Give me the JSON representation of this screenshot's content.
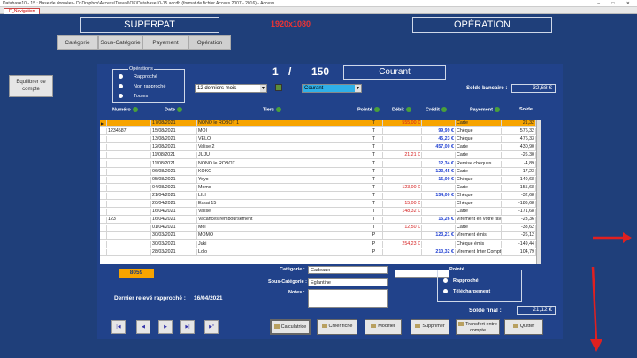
{
  "window": {
    "title": "Database10 - 15 : Base de données- D:\\Dropbox\\Access\\Travail\\OK\\Database10-15.accdb (format de fichier Access 2007 - 2016) - Access",
    "nav_tab": "F_Navigation",
    "controls": [
      "–",
      "□",
      "✕"
    ]
  },
  "header": {
    "left_title": "SUPERPAT",
    "resolution": "1920x1080",
    "right_title": "OPÉRATION"
  },
  "tabs": [
    "Catégorie",
    "Sous-Catégorie",
    "Payement",
    "Opération"
  ],
  "left_button": "Equilibrer ce compte",
  "operations_filter": {
    "legend": "Opérations",
    "options": [
      "Rapproché",
      "Non rapproché",
      "Toutes"
    ]
  },
  "pager": {
    "current": "1",
    "separator": "/",
    "total": "150"
  },
  "account_name": "Courant",
  "period_select": "12 derniers mois",
  "account_select": "Courant",
  "bank_balance": {
    "label": "Solde bancaire :",
    "value": "-32,68 €"
  },
  "columns": [
    "Numéro",
    "Date",
    "Tiers",
    "Pointé",
    "Débit",
    "Crédit",
    "Payement",
    "Solde"
  ],
  "rows": [
    {
      "num": "",
      "date": "17/08/2021",
      "tiers": "NONO le ROBOT 1",
      "pointe": "T",
      "debit": "555,00 €",
      "credit": "",
      "payement": "Carte",
      "solde": "21,32"
    },
    {
      "num": "1234587",
      "date": "15/08/2021",
      "tiers": "MOI",
      "pointe": "T",
      "debit": "",
      "credit": "99,99 €",
      "payement": "Chèque",
      "solde": "576,32"
    },
    {
      "num": "",
      "date": "13/08/2021",
      "tiers": "VELO",
      "pointe": "T",
      "debit": "",
      "credit": "45,23 €",
      "payement": "Chèque",
      "solde": "476,33"
    },
    {
      "num": "",
      "date": "12/08/2021",
      "tiers": "Valise 2",
      "pointe": "T",
      "debit": "",
      "credit": "457,00 €",
      "payement": "Carte",
      "solde": "430,90"
    },
    {
      "num": "",
      "date": "11/08/2021",
      "tiers": "JUJU",
      "pointe": "T",
      "debit": "21,21 €",
      "credit": "",
      "payement": "Carte",
      "solde": "-26,30"
    },
    {
      "num": "",
      "date": "11/08/2021",
      "tiers": "NONO le ROBOT",
      "pointe": "T",
      "debit": "",
      "credit": "12,34 €",
      "payement": "Remise chèques",
      "solde": "-4,89"
    },
    {
      "num": "",
      "date": "06/08/2021",
      "tiers": "KOKO",
      "pointe": "T",
      "debit": "",
      "credit": "123,45 €",
      "payement": "Carte",
      "solde": "-17,23"
    },
    {
      "num": "",
      "date": "05/08/2021",
      "tiers": "Yoyo",
      "pointe": "T",
      "debit": "",
      "credit": "15,00 €",
      "payement": "Chèque",
      "solde": "-140,68"
    },
    {
      "num": "",
      "date": "04/08/2021",
      "tiers": "Momo",
      "pointe": "T",
      "debit": "123,00 €",
      "credit": "",
      "payement": "Carte",
      "solde": "-155,68"
    },
    {
      "num": "",
      "date": "21/04/2021",
      "tiers": "LILI",
      "pointe": "T",
      "debit": "",
      "credit": "154,00 €",
      "payement": "Chèque",
      "solde": "-32,68"
    },
    {
      "num": "",
      "date": "20/04/2021",
      "tiers": "Essai 15",
      "pointe": "T",
      "debit": "15,00 €",
      "credit": "",
      "payement": "Chèque",
      "solde": "-186,68"
    },
    {
      "num": "",
      "date": "16/04/2021",
      "tiers": "Valise",
      "pointe": "T",
      "debit": "148,32 €",
      "credit": "",
      "payement": "Carte",
      "solde": "-171,68"
    },
    {
      "num": "123",
      "date": "16/04/2021",
      "tiers": "Vacances remboursement",
      "pointe": "T",
      "debit": "",
      "credit": "15,26 €",
      "payement": "Virement en votre faveur",
      "solde": "-23,36"
    },
    {
      "num": "",
      "date": "01/04/2021",
      "tiers": "Moi",
      "pointe": "T",
      "debit": "12,50 €",
      "credit": "",
      "payement": "Carte",
      "solde": "-38,62"
    },
    {
      "num": "",
      "date": "30/03/2021",
      "tiers": "MOMO",
      "pointe": "P",
      "debit": "",
      "credit": "123,21 €",
      "payement": "Virement émis",
      "solde": "-26,12"
    },
    {
      "num": "",
      "date": "30/03/2021",
      "tiers": "Juki",
      "pointe": "P",
      "debit": "254,23 €",
      "credit": "",
      "payement": "Chèque émis",
      "solde": "-149,44"
    },
    {
      "num": "",
      "date": "28/03/2021",
      "tiers": "Lolo",
      "pointe": "P",
      "debit": "",
      "credit": "210,32 €",
      "payement": "Virement Inter Compte",
      "solde": "104,79"
    }
  ],
  "record_count": "8059",
  "detail": {
    "categorie_label": "Catégorie :",
    "categorie_value": "Cadeaux",
    "sous_categorie_label": "Sous-Catégorie :",
    "sous_categorie_value": "Eglantine",
    "notes_label": "Notes :"
  },
  "pointe_group": {
    "legend": "Pointé",
    "options": [
      "Rapproché",
      "Téléchargement"
    ]
  },
  "last_reconciled": {
    "label": "Dernier relevé rapproché :",
    "value": "16/04/2021"
  },
  "final_balance": {
    "label": "Solde final :",
    "value": "21,12 €"
  },
  "nav_buttons": [
    "|◀",
    "◀",
    "▶",
    "▶|",
    "▶*"
  ],
  "actions": [
    "Calculatrice",
    "Créer fiche",
    "Modifier",
    "Supprimer",
    "Transfert entre compte",
    "Quitter"
  ],
  "colors": {
    "background": "#1f3f7a",
    "selected_row": "#f7a400",
    "debit": "#d41c1c",
    "credit": "#1f3fd1",
    "arrow": "#e02020"
  }
}
